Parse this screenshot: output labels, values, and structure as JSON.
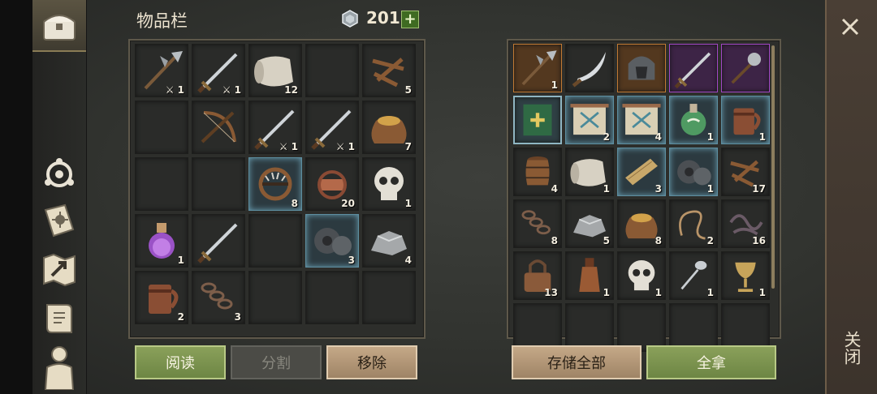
{
  "header": {
    "title": "物品栏",
    "currency_value": "201",
    "currency_plus": "+"
  },
  "close": {
    "icon": "close-icon",
    "label": "关闭"
  },
  "sidebar": {
    "items": [
      {
        "name": "chest-icon"
      },
      {
        "name": "compass-icon"
      },
      {
        "name": "recipe-book-icon"
      },
      {
        "name": "map-icon"
      },
      {
        "name": "scroll-icon"
      },
      {
        "name": "character-icon"
      }
    ]
  },
  "inventory": {
    "cells": [
      {
        "icon": "halberd-icon",
        "count": "1",
        "mark": "⚔"
      },
      {
        "icon": "sword-icon",
        "count": "1",
        "mark": "⚔"
      },
      {
        "icon": "cloth-roll-icon",
        "count": "12"
      },
      {
        "icon": "empty",
        "count": ""
      },
      {
        "icon": "nails-icon",
        "count": "5"
      },
      {
        "icon": "empty",
        "count": ""
      },
      {
        "icon": "crossbow-icon",
        "count": ""
      },
      {
        "icon": "sword-icon",
        "count": "1",
        "mark": "⚔"
      },
      {
        "icon": "sword-icon",
        "count": "1",
        "mark": "⚔"
      },
      {
        "icon": "sack-icon",
        "count": "7"
      },
      {
        "icon": "empty",
        "count": ""
      },
      {
        "icon": "empty",
        "count": ""
      },
      {
        "icon": "bear-trap-icon",
        "count": "8"
      },
      {
        "icon": "trap-icon",
        "count": "20"
      },
      {
        "icon": "skull-icon",
        "count": "1"
      },
      {
        "icon": "potion-icon",
        "count": "1"
      },
      {
        "icon": "sword-icon",
        "count": ""
      },
      {
        "icon": "empty",
        "count": ""
      },
      {
        "icon": "gears-icon",
        "count": "3"
      },
      {
        "icon": "ore-icon",
        "count": "4"
      },
      {
        "icon": "mug-icon",
        "count": "2"
      },
      {
        "icon": "chain-icon",
        "count": "3"
      },
      {
        "icon": "empty",
        "count": ""
      },
      {
        "icon": "empty",
        "count": ""
      },
      {
        "icon": "empty",
        "count": ""
      }
    ],
    "buttons": {
      "read": "阅读",
      "split": "分割",
      "remove": "移除"
    }
  },
  "storage": {
    "cells": [
      {
        "icon": "halberd-icon",
        "count": "1"
      },
      {
        "icon": "scimitar-icon",
        "count": ""
      },
      {
        "icon": "helmet-icon",
        "count": ""
      },
      {
        "icon": "sword-icon",
        "count": ""
      },
      {
        "icon": "mace-icon",
        "count": ""
      },
      {
        "icon": "book-icon",
        "count": ""
      },
      {
        "icon": "scroll-icon",
        "count": "2"
      },
      {
        "icon": "scroll-icon",
        "count": "4"
      },
      {
        "icon": "flask-icon",
        "count": "1"
      },
      {
        "icon": "mug-icon",
        "count": "1"
      },
      {
        "icon": "barrel-icon",
        "count": "4"
      },
      {
        "icon": "cloth-roll-icon",
        "count": "1"
      },
      {
        "icon": "plank-icon",
        "count": "3"
      },
      {
        "icon": "gears-icon",
        "count": "1"
      },
      {
        "icon": "nails-icon",
        "count": "17"
      },
      {
        "icon": "chain-icon",
        "count": "8"
      },
      {
        "icon": "ore-icon",
        "count": "5"
      },
      {
        "icon": "sack-icon",
        "count": "8"
      },
      {
        "icon": "rope-icon",
        "count": "2"
      },
      {
        "icon": "roots-icon",
        "count": "16"
      },
      {
        "icon": "lock-icon",
        "count": "13"
      },
      {
        "icon": "bottle-icon",
        "count": "1"
      },
      {
        "icon": "skull-icon",
        "count": "1"
      },
      {
        "icon": "spoon-icon",
        "count": "1"
      },
      {
        "icon": "goblet-icon",
        "count": "1"
      },
      {
        "icon": "empty",
        "count": ""
      },
      {
        "icon": "empty",
        "count": ""
      },
      {
        "icon": "empty",
        "count": ""
      },
      {
        "icon": "empty",
        "count": ""
      },
      {
        "icon": "empty",
        "count": ""
      }
    ],
    "buttons": {
      "store_all": "存储全部",
      "take_all": "全拿"
    }
  }
}
